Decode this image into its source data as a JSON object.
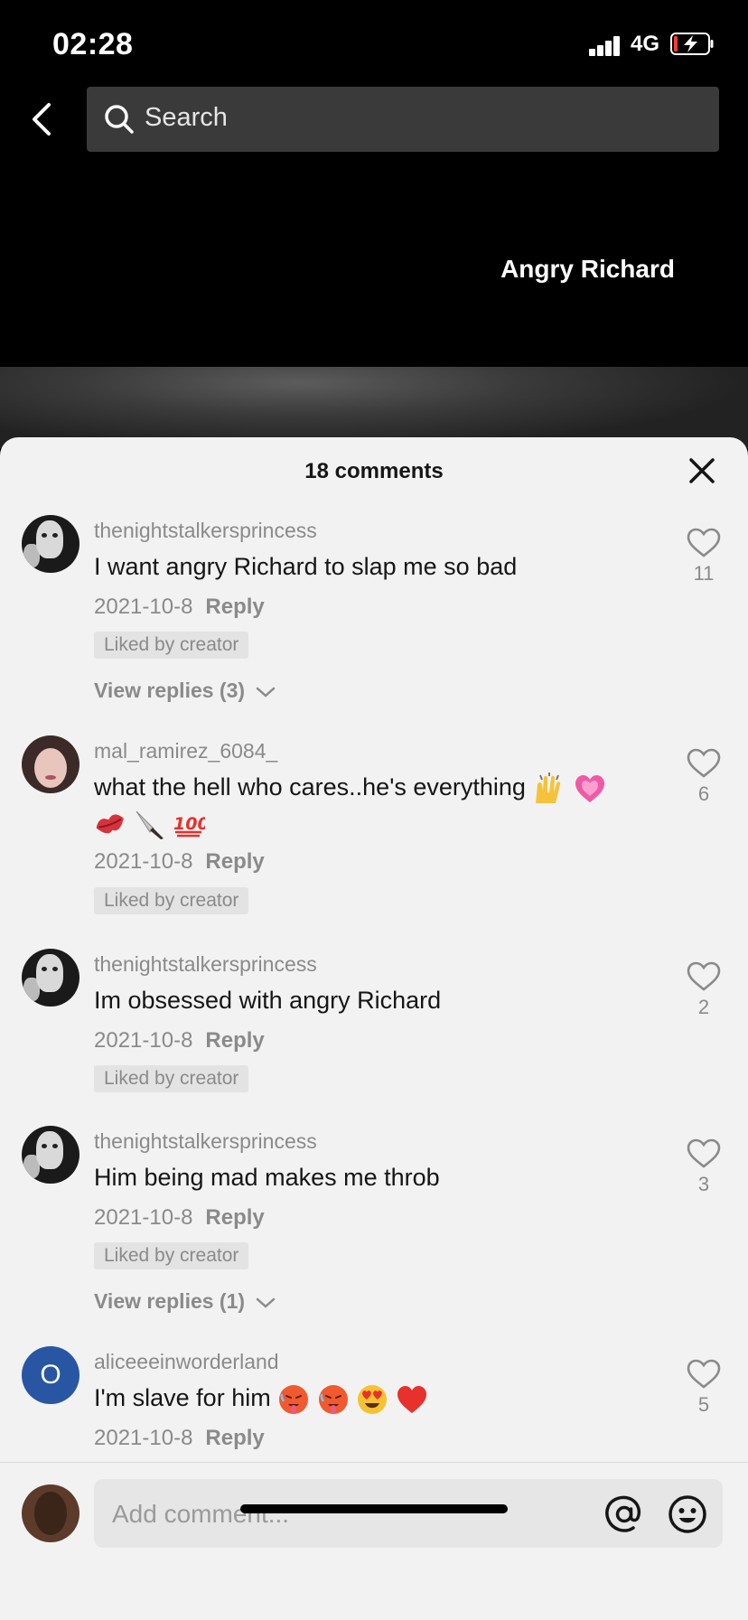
{
  "status_bar": {
    "time": "02:28",
    "network": "4G"
  },
  "header": {
    "search_placeholder": "Search"
  },
  "video": {
    "caption": "Angry Richard"
  },
  "comments_panel": {
    "title": "18 comments",
    "comments": [
      {
        "username": "thenightstalkersprincess",
        "text": "I want angry Richard to slap me so bad",
        "date": "2021-10-8",
        "reply_label": "Reply",
        "badge": "Liked by creator",
        "view_replies": "View replies (3)",
        "likes": "11"
      },
      {
        "username": "mal_ramirez_6084_",
        "text": "what the hell who cares..he's everything",
        "date": "2021-10-8",
        "reply_label": "Reply",
        "badge": "Liked by creator",
        "likes": "6"
      },
      {
        "username": "thenightstalkersprincess",
        "text": "Im obsessed with angry Richard",
        "date": "2021-10-8",
        "reply_label": "Reply",
        "badge": "Liked by creator",
        "likes": "2"
      },
      {
        "username": "thenightstalkersprincess",
        "text": "Him being mad makes me throb",
        "date": "2021-10-8",
        "reply_label": "Reply",
        "badge": "Liked by creator",
        "view_replies": "View replies (1)",
        "likes": "3"
      },
      {
        "username": "aliceeeinworderland",
        "avatar_letter": "O",
        "text": "I'm slave for him",
        "date": "2021-10-8",
        "reply_label": "Reply",
        "likes": "5"
      }
    ]
  },
  "bottom_bar": {
    "input_placeholder": "Add comment..."
  },
  "colors": {
    "sheet_bg": "#f2f2f2",
    "muted": "#8a8a8a",
    "avatar_blue": "#2956a3"
  },
  "icons": [
    "back-chevron-icon",
    "search-icon",
    "close-icon",
    "heart-icon",
    "chevron-down-icon",
    "at-sign-icon",
    "smiley-icon"
  ]
}
